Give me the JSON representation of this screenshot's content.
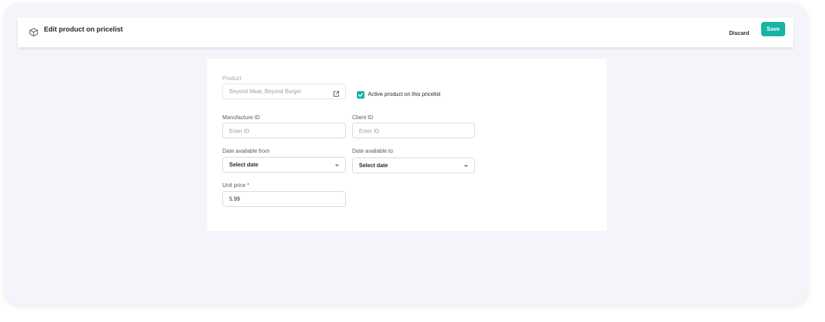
{
  "header": {
    "title": "Edit product on pricelist",
    "icon": "box-icon",
    "discard_label": "Discard",
    "save_label": "Save"
  },
  "form": {
    "product": {
      "label": "Product",
      "value": "Beyond Meat, Beyond Burger",
      "icon": "external-link-icon"
    },
    "active": {
      "label": "Active product on this pricelist",
      "checked": true
    },
    "manufacture_id": {
      "label": "Manufacture ID",
      "placeholder": "Enter ID",
      "value": ""
    },
    "client_id": {
      "label": "Client ID",
      "placeholder": "Enter ID",
      "value": ""
    },
    "date_from": {
      "label": "Date available from",
      "value": "Select date"
    },
    "date_to": {
      "label": "Date available to",
      "value": "Select date"
    },
    "unit_price": {
      "label": "Unit price *",
      "value": "5.99"
    }
  },
  "colors": {
    "accent": "#19b3a6",
    "background": "#f4f5fa",
    "text": "#23262b"
  }
}
